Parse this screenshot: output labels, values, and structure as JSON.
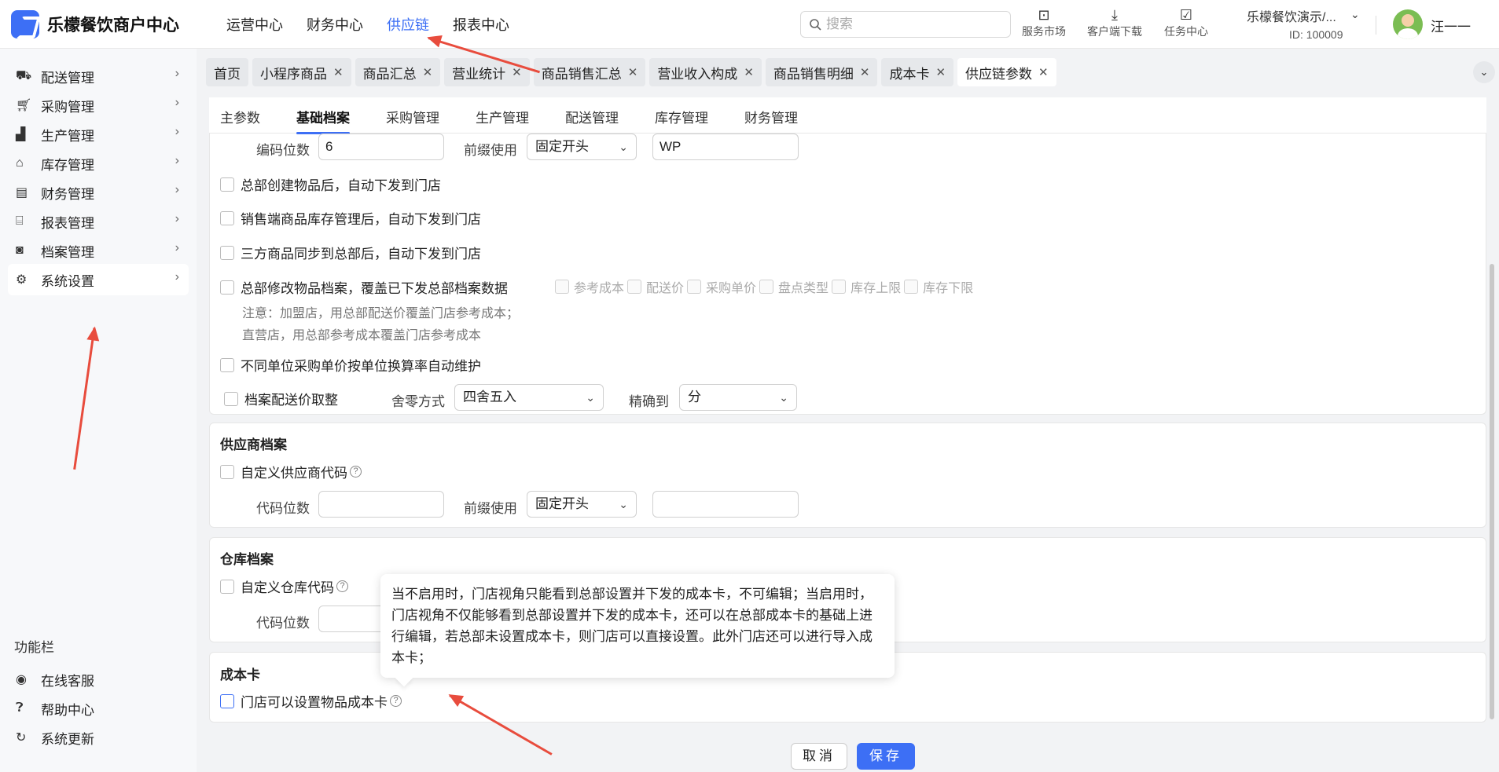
{
  "app": {
    "title": "乐檬餐饮商户中心"
  },
  "topnav": [
    {
      "label": "运营中心",
      "active": false
    },
    {
      "label": "财务中心",
      "active": false
    },
    {
      "label": "供应链",
      "active": true
    },
    {
      "label": "报表中心",
      "active": false
    }
  ],
  "search": {
    "placeholder": "搜索"
  },
  "tools": {
    "market": "服务市场",
    "download": "客户端下载",
    "tasks": "任务中心"
  },
  "merchant": {
    "name": "乐檬餐饮演示/...",
    "id": "ID: 100009"
  },
  "user": {
    "name": "汪一一"
  },
  "sidebar": {
    "items": [
      {
        "label": "配送管理",
        "icon": "truck-icon"
      },
      {
        "label": "采购管理",
        "icon": "cart-icon"
      },
      {
        "label": "生产管理",
        "icon": "factory-icon"
      },
      {
        "label": "库存管理",
        "icon": "warehouse-icon"
      },
      {
        "label": "财务管理",
        "icon": "cash-register-icon"
      },
      {
        "label": "报表管理",
        "icon": "store-icon"
      },
      {
        "label": "档案管理",
        "icon": "archive-icon"
      },
      {
        "label": "系统设置",
        "icon": "gear-icon",
        "active": true
      }
    ],
    "section": "功能栏",
    "tools": [
      {
        "label": "在线客服",
        "icon": "headset-icon"
      },
      {
        "label": "帮助中心",
        "icon": "help-icon"
      },
      {
        "label": "系统更新",
        "icon": "refresh-icon"
      }
    ]
  },
  "tabs": [
    {
      "label": "首页",
      "closable": false
    },
    {
      "label": "小程序商品",
      "closable": true
    },
    {
      "label": "商品汇总",
      "closable": true
    },
    {
      "label": "营业统计",
      "closable": true
    },
    {
      "label": "商品销售汇总",
      "closable": true
    },
    {
      "label": "营业收入构成",
      "closable": true
    },
    {
      "label": "商品销售明细",
      "closable": true
    },
    {
      "label": "成本卡",
      "closable": true
    },
    {
      "label": "供应链参数",
      "closable": true,
      "active": true
    }
  ],
  "subtabs": [
    {
      "label": "主参数"
    },
    {
      "label": "基础档案",
      "active": true
    },
    {
      "label": "采购管理"
    },
    {
      "label": "生产管理"
    },
    {
      "label": "配送管理"
    },
    {
      "label": "库存管理"
    },
    {
      "label": "财务管理"
    }
  ],
  "item_code": {
    "digits_label": "编码位数",
    "digits_value": "6",
    "prefix_label": "前缀使用",
    "prefix_value": "固定开头",
    "prefix_text": "WP"
  },
  "options": {
    "opt1": "总部创建物品后，自动下发到门店",
    "opt2": "销售端商品库存管理后，自动下发到门店",
    "opt3": "三方商品同步到总部后，自动下发到门店",
    "opt4": "总部修改物品档案，覆盖已下发总部档案数据",
    "opt4_sub": [
      "参考成本",
      "配送价",
      "采购单价",
      "盘点类型",
      "库存上限",
      "库存下限"
    ],
    "note1": "注意：加盟店，用总部配送价覆盖门店参考成本；",
    "note2": "直营店，用总部参考成本覆盖门店参考成本",
    "opt5": "不同单位采购单价按单位换算率自动维护",
    "opt6": "档案配送价取整",
    "round_label": "舍零方式",
    "round_value": "四舍五入",
    "precision_label": "精确到",
    "precision_value": "分"
  },
  "supplier": {
    "title": "供应商档案",
    "custom_label": "自定义供应商代码",
    "digits_label": "代码位数",
    "prefix_label": "前缀使用",
    "prefix_value": "固定开头"
  },
  "warehouse": {
    "title": "仓库档案",
    "custom_label": "自定义仓库代码",
    "digits_label": "代码位数"
  },
  "costcard": {
    "title": "成本卡",
    "option_label": "门店可以设置物品成本卡"
  },
  "tooltip": {
    "text": "当不启用时，门店视角只能看到总部设置并下发的成本卡，不可编辑；当启用时，门店视角不仅能够看到总部设置并下发的成本卡，还可以在总部成本卡的基础上进行编辑，若总部未设置成本卡，则门店可以直接设置。此外门店还可以进行导入成本卡；"
  },
  "footer": {
    "cancel": "取消",
    "save": "保存"
  },
  "colors": {
    "accent": "#3d6ff5",
    "annotation": "#e84c3d"
  }
}
